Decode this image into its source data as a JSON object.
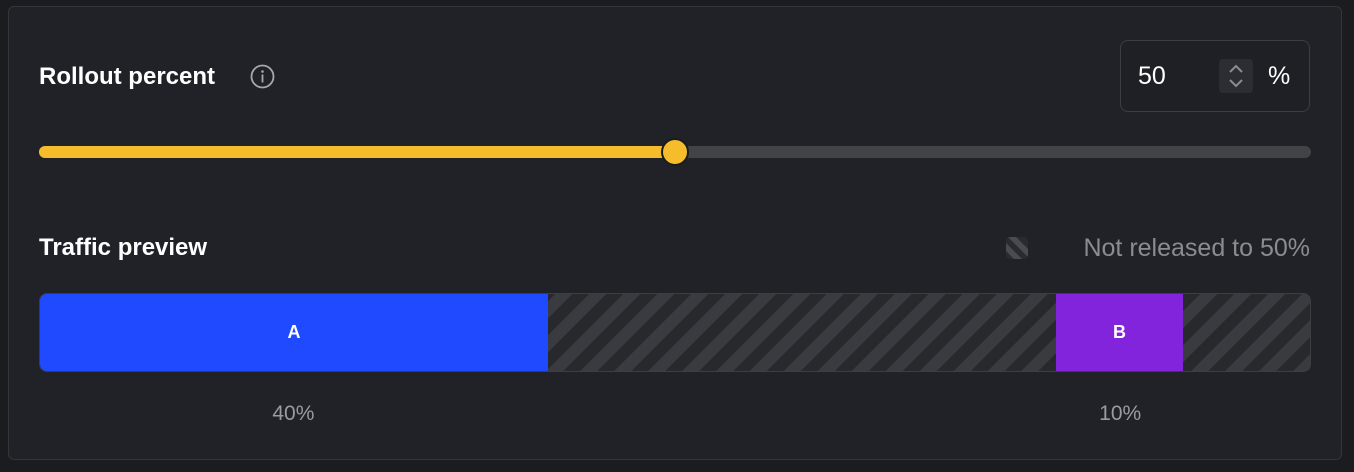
{
  "rollout": {
    "title": "Rollout percent",
    "info_icon": "info-icon",
    "value": "50",
    "unit": "%",
    "slider_fraction": 0.5
  },
  "traffic": {
    "title": "Traffic preview",
    "legend_icon": "striped-square-icon",
    "legend_label": "Not released to 50%",
    "segments": [
      {
        "label": "A",
        "start_fraction": 0.0,
        "fraction": 0.4,
        "percent_label": "40%",
        "color": "#1f4aff"
      },
      {
        "label": "B",
        "start_fraction": 0.8,
        "fraction": 0.1,
        "percent_label": "10%",
        "color": "#8224dc"
      }
    ]
  },
  "colors": {
    "accent": "#f5bc2c",
    "track": "#424347",
    "background": "#212227"
  }
}
